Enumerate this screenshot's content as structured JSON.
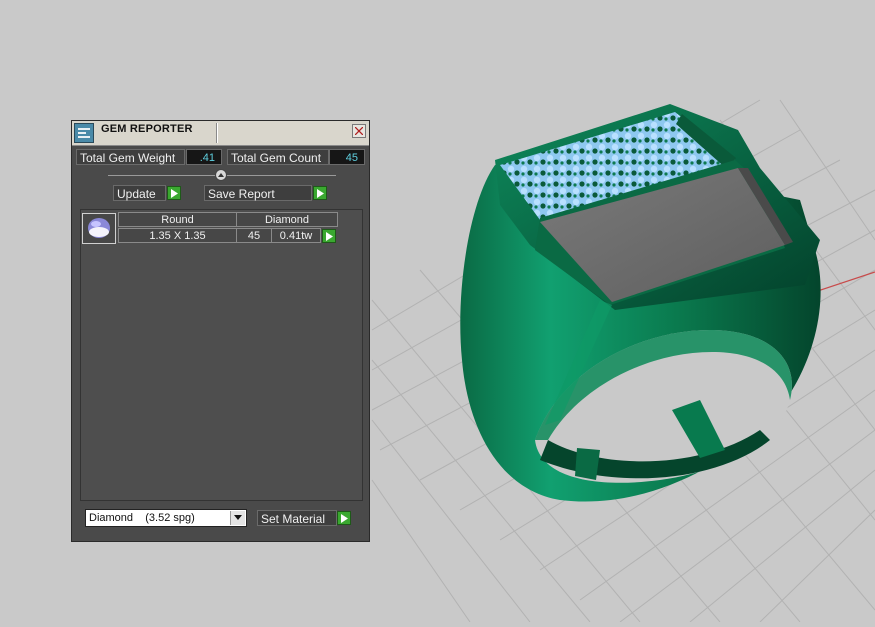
{
  "window": {
    "title": "GEM REPORTER"
  },
  "summary": {
    "weight_label": "Total Gem Weight",
    "weight_value": ".41",
    "count_label": "Total Gem Count",
    "count_value": "45"
  },
  "actions": {
    "update_label": "Update",
    "save_report_label": "Save Report",
    "set_material_label": "Set Material"
  },
  "gems": [
    {
      "shape": "Round",
      "material": "Diamond",
      "size": "1.35 X 1.35",
      "count": "45",
      "weight": "0.41tw"
    }
  ],
  "material_select": {
    "value": "Diamond    (3.52 spg)"
  },
  "colors": {
    "panel_bg": "#4a4a4a",
    "value_text": "#5fd0e0",
    "play_green": "#3aa830",
    "ring_green": "#0a7a4e",
    "viewport_bg": "#c9c9c9"
  },
  "icons": {
    "app": "gem-reporter-app-icon",
    "close": "close-icon",
    "slider": "slider-handle-icon",
    "play": "play-arrow-icon",
    "gem_thumbnail": "round-gem-icon",
    "dropdown": "chevron-down-icon"
  }
}
